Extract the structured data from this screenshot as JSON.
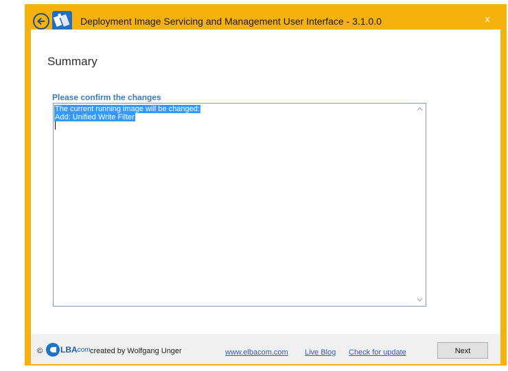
{
  "window": {
    "title": "Deployment Image Servicing and Management User Interface - 3.1.0.0",
    "close_label": "x",
    "accent_color": "#f5b20e"
  },
  "page": {
    "heading": "Summary",
    "confirm_label": "Please confirm the changes",
    "changes_lines": [
      "The current running image will be changed:",
      "Add: Unified Write Filter"
    ]
  },
  "footer": {
    "copyright": "©",
    "logo_main": "LBA",
    "logo_suffix": "com",
    "created_by": "created by Wolfgang Unger",
    "links": [
      "www.elbacom.com",
      "Live Blog",
      "Check for update"
    ],
    "next_label": "Next"
  },
  "icons": [
    "back-arrow-icon",
    "app-icon",
    "close-icon",
    "scroll-up-icon",
    "scroll-down-icon",
    "elbacom-logo-icon"
  ]
}
